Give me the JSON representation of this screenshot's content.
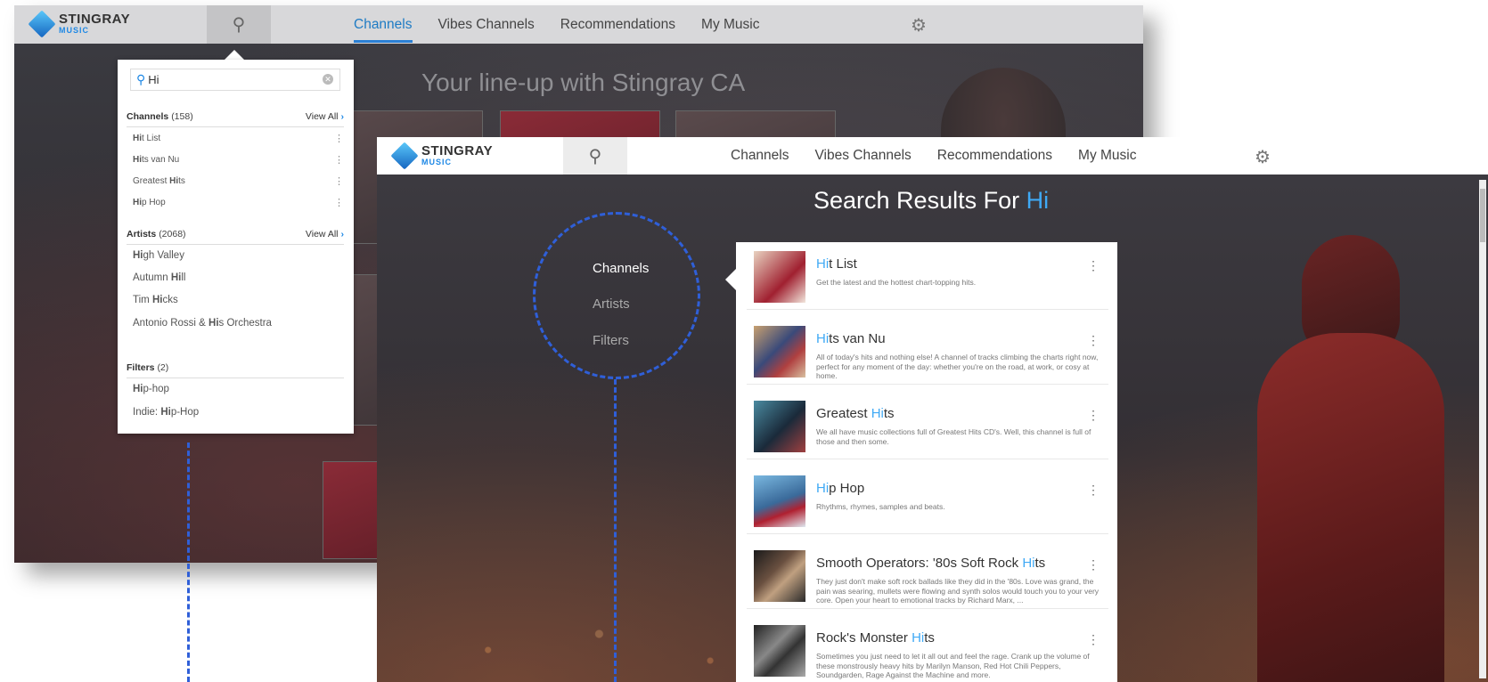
{
  "logo": {
    "brand": "STINGRAY",
    "sub": "MUSIC"
  },
  "nav": {
    "tabs": [
      "Channels",
      "Vibes Channels",
      "Recommendations",
      "My Music"
    ]
  },
  "window1": {
    "lineup_title": "Your line-up with Stingray CA"
  },
  "dropdown": {
    "query": "Hi",
    "channels": {
      "label": "Channels",
      "count": "(158)",
      "view_all": "View All",
      "items": [
        {
          "hl": "Hi",
          "rest": "t List"
        },
        {
          "hl": "Hi",
          "rest": "ts van Nu"
        },
        {
          "pre": "Greatest ",
          "hl": "Hi",
          "rest": "ts"
        },
        {
          "hl": "Hi",
          "rest": "p Hop"
        }
      ]
    },
    "artists": {
      "label": "Artists",
      "count": "(2068)",
      "view_all": "View All",
      "items": [
        {
          "hl": "Hi",
          "rest": "gh Valley"
        },
        {
          "pre": "Autumn ",
          "hl": "Hi",
          "rest": "ll"
        },
        {
          "pre": "Tim ",
          "hl": "Hi",
          "rest": "cks"
        },
        {
          "pre": "Antonio Rossi & ",
          "hl": "Hi",
          "rest": "s Orchestra"
        }
      ]
    },
    "filters": {
      "label": "Filters",
      "count": "(2)",
      "items": [
        {
          "hl": "Hi",
          "rest": "p-hop"
        },
        {
          "pre": "Indie: ",
          "hl": "Hi",
          "rest": "p-Hop"
        }
      ]
    }
  },
  "results_page": {
    "title_prefix": "Search Results For ",
    "query": "Hi",
    "filters": [
      "Channels",
      "Artists",
      "Filters"
    ],
    "results": [
      {
        "hl": "Hi",
        "rest": "t List",
        "desc": "Get the latest and the hottest chart-topping hits."
      },
      {
        "hl": "Hi",
        "rest": "ts van Nu",
        "desc": "All of today's hits and nothing else! A channel of tracks climbing the charts right now, perfect for any moment of the day: whether you're on the road, at work, or cosy at home."
      },
      {
        "pre": "Greatest ",
        "hl": "Hi",
        "rest": "ts",
        "desc": "We all have music collections full of Greatest Hits CD's. Well, this channel is full of those and then some."
      },
      {
        "hl": "Hi",
        "rest": "p Hop",
        "desc": "Rhythms, rhymes, samples and beats."
      },
      {
        "pre": "Smooth Operators: '80s Soft Rock ",
        "hl": "Hi",
        "rest": "ts",
        "desc": "They just don't make soft rock ballads like they did in the '80s. Love was grand, the pain was searing, mullets were flowing and synth solos would touch you to your very core. Open your heart to emotional tracks by Richard Marx, ..."
      },
      {
        "pre": "Rock's Monster ",
        "hl": "Hi",
        "rest": "ts",
        "desc": "Sometimes you just need to let it all out and feel the rage. Crank up the volume of these monstrously heavy hits by Marilyn Manson, Red Hot Chili Peppers, Soundgarden, Rage Against the Machine and more."
      }
    ]
  },
  "colors": {
    "accent": "#3fa9f5",
    "dashed": "#2f5fd8",
    "active_tab": "#1e7bc4"
  },
  "icons": {
    "search": "search-icon",
    "settings": "gear-icon",
    "more": "more-vertical-icon",
    "clear": "clear-icon"
  }
}
